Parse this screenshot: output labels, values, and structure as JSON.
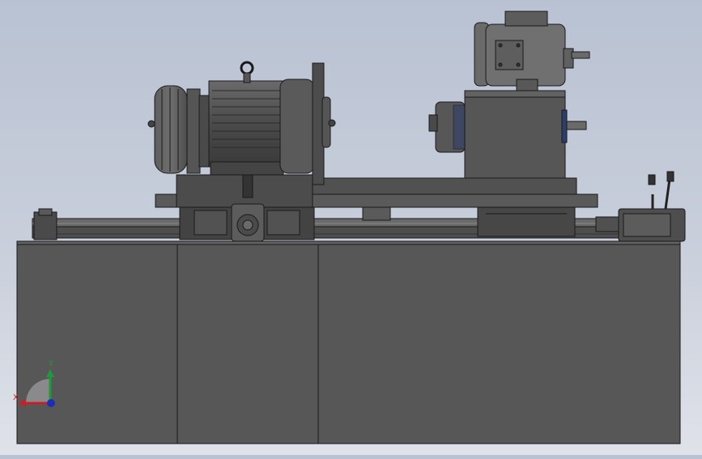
{
  "scene": {
    "description_free": true,
    "colors": {
      "metal_dark": "#3c3c3c",
      "metal": "#5a5a5a",
      "metal_light": "#777777",
      "edge": "#1a1a1a",
      "highlight": "#9a9a9a"
    }
  },
  "triad": {
    "x_label": "X",
    "y_label": "Y",
    "x_color": "#c8202a",
    "y_color": "#1f9a3a",
    "z_color": "#1c2fb0"
  }
}
